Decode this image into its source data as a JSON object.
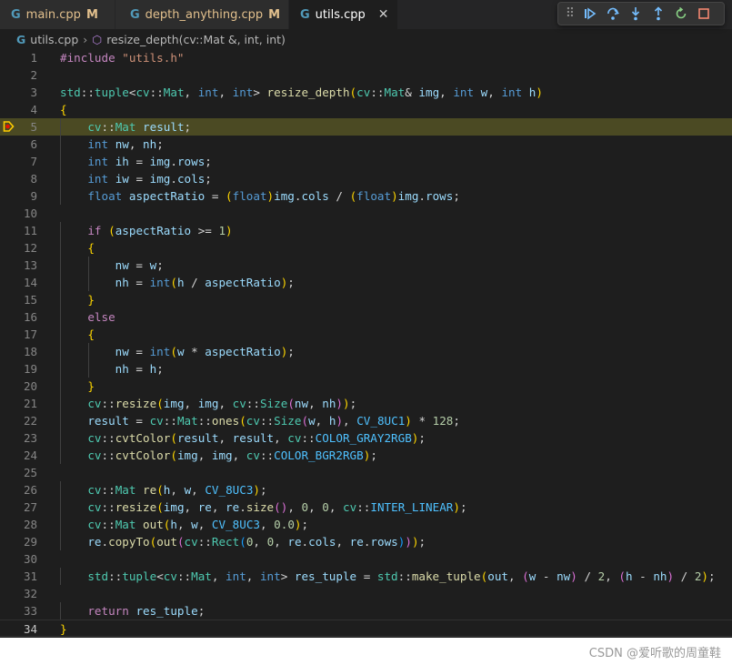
{
  "tabs": [
    {
      "label": "main.cpp",
      "modified": "M",
      "icon": "cpp-icon"
    },
    {
      "label": "depth_anything.cpp",
      "modified": "M",
      "icon": "cpp-icon"
    },
    {
      "label": "utils.cpp",
      "icon": "cpp-icon",
      "active": true,
      "close": "✕"
    }
  ],
  "breadcrumbs": {
    "file": "utils.cpp",
    "symbol": "resize_depth(cv::Mat &, int, int)"
  },
  "debug_toolbar": [
    "continue",
    "step-over",
    "step-into",
    "step-out",
    "restart",
    "stop"
  ],
  "editor": {
    "current_line": 5,
    "last_line": 34,
    "lines": [
      "#include \"utils.h\"",
      "",
      "std::tuple<cv::Mat, int, int> resize_depth(cv::Mat& img, int w, int h)",
      "{",
      "    cv::Mat result;",
      "    int nw, nh;",
      "    int ih = img.rows;",
      "    int iw = img.cols;",
      "    float aspectRatio = (float)img.cols / (float)img.rows;",
      "",
      "    if (aspectRatio >= 1)",
      "    {",
      "        nw = w;",
      "        nh = int(h / aspectRatio);",
      "    }",
      "    else",
      "    {",
      "        nw = int(w * aspectRatio);",
      "        nh = h;",
      "    }",
      "    cv::resize(img, img, cv::Size(nw, nh));",
      "    result = cv::Mat::ones(cv::Size(w, h), CV_8UC1) * 128;",
      "    cv::cvtColor(result, result, cv::COLOR_GRAY2RGB);",
      "    cv::cvtColor(img, img, cv::COLOR_BGR2RGB);",
      "",
      "    cv::Mat re(h, w, CV_8UC3);",
      "    cv::resize(img, re, re.size(), 0, 0, cv::INTER_LINEAR);",
      "    cv::Mat out(h, w, CV_8UC3, 0.0);",
      "    re.copyTo(out(cv::Rect(0, 0, re.cols, re.rows)));",
      "",
      "    std::tuple<cv::Mat, int, int> res_tuple = std::make_tuple(out, (w - nw) / 2, (h - nh) / 2);",
      "",
      "    return res_tuple;",
      "}"
    ]
  },
  "watermark": "CSDN @爱听歌的周童鞋",
  "colors": {
    "editor_bg": "#1e1e1e",
    "current_line_bg": "#4b4a23",
    "modified_tab": "#e2c08d",
    "keyword": "#569cd6"
  }
}
